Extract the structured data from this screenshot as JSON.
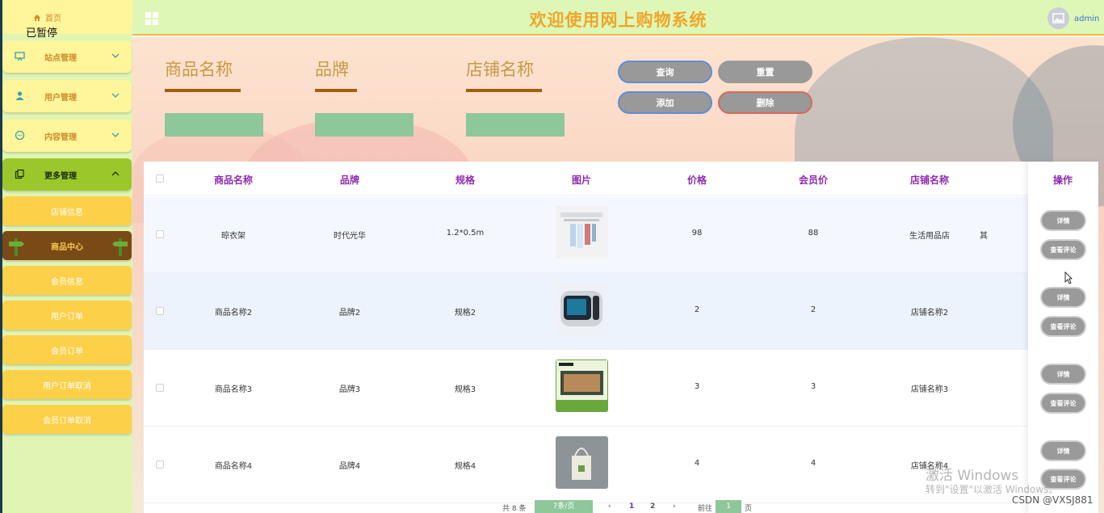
{
  "sidebar": {
    "home_label": "首页",
    "paused_label": "已暂停",
    "menus": [
      {
        "label": "站点管理"
      },
      {
        "label": "用户管理"
      },
      {
        "label": "内容管理"
      },
      {
        "label": "更多管理"
      }
    ],
    "submenus": [
      {
        "label": "店铺信息"
      },
      {
        "label": "商品中心"
      },
      {
        "label": "会员信息"
      },
      {
        "label": "用户订单"
      },
      {
        "label": "会员订单"
      },
      {
        "label": "用户订单取消"
      },
      {
        "label": "会员订单取消"
      }
    ]
  },
  "header": {
    "title": "欢迎使用网上购物系统",
    "user": "admin"
  },
  "search": {
    "fields": [
      {
        "label": "商品名称"
      },
      {
        "label": "品牌"
      },
      {
        "label": "店铺名称"
      }
    ],
    "buttons": {
      "query": "查询",
      "reset": "重置",
      "add": "添加",
      "delete": "删除"
    }
  },
  "table": {
    "headers": [
      "商品名称",
      "品牌",
      "规格",
      "图片",
      "价格",
      "会员价",
      "店铺名称",
      "操作"
    ],
    "rows": [
      {
        "name": "晾衣架",
        "brand": "时代光华",
        "spec": "1.2*0.5m",
        "price": "98",
        "member_price": "88",
        "shop": "生活用品店",
        "extra": "其"
      },
      {
        "name": "商品名称2",
        "brand": "品牌2",
        "spec": "规格2",
        "price": "2",
        "member_price": "2",
        "shop": "店铺名称2"
      },
      {
        "name": "商品名称3",
        "brand": "品牌3",
        "spec": "规格3",
        "price": "3",
        "member_price": "3",
        "shop": "店铺名称3"
      },
      {
        "name": "商品名称4",
        "brand": "品牌4",
        "spec": "规格4",
        "price": "4",
        "member_price": "4",
        "shop": "店铺名称4"
      }
    ],
    "actions": {
      "detail": "详情",
      "reviews": "查看评论"
    }
  },
  "pager": {
    "total": "共 8 条",
    "page_size": "7条/页",
    "prev": "‹",
    "pages": [
      "1",
      "2"
    ],
    "next": "›",
    "goto_prefix": "前往",
    "goto_value": "1",
    "goto_suffix": "页"
  },
  "overlay": {
    "activate_title": "激活 Windows",
    "activate_sub": "转到\"设置\"以激活 Windows。",
    "csdn": "CSDN @VXSJ881"
  }
}
